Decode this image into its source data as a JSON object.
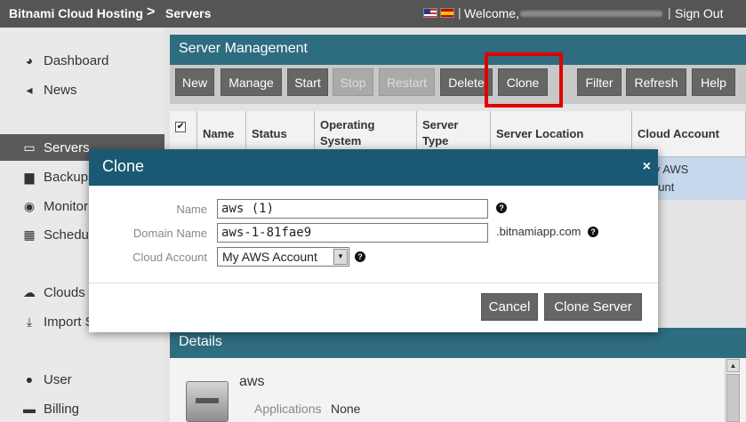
{
  "topbar": {
    "crumb1": "Bitnami Cloud Hosting",
    "separator": ">",
    "crumb2": "Servers",
    "flags": [
      "us-flag",
      "es-flag"
    ],
    "pipe": "|",
    "welcome": "Welcome,",
    "signout": "Sign Out"
  },
  "sidebar": {
    "items": [
      {
        "label": "Dashboard",
        "icon": "dashboard-icon",
        "glyph": "◕"
      },
      {
        "label": "News",
        "icon": "megaphone-icon",
        "glyph": "📢"
      },
      {
        "label": "Servers",
        "icon": "server-icon",
        "glyph": "▭"
      },
      {
        "label": "Backups",
        "icon": "archive-icon",
        "glyph": "▆"
      },
      {
        "label": "Monitor",
        "icon": "eye-icon",
        "glyph": "◉"
      },
      {
        "label": "Schedule",
        "icon": "calendar-icon",
        "glyph": "▦"
      },
      {
        "label": "Clouds",
        "icon": "cloud-icon",
        "glyph": "☁"
      },
      {
        "label": "Import Server",
        "icon": "import-icon",
        "glyph": "⤓"
      },
      {
        "label": "User",
        "icon": "user-icon",
        "glyph": "●"
      },
      {
        "label": "Billing",
        "icon": "credit-card-icon",
        "glyph": "▬"
      }
    ]
  },
  "main": {
    "title": "Server Management",
    "toolbar": {
      "new": "New",
      "manage": "Manage",
      "start": "Start",
      "stop": "Stop",
      "restart": "Restart",
      "delete": "Delete",
      "clone": "Clone",
      "filter": "Filter",
      "refresh": "Refresh",
      "help": "Help"
    },
    "table": {
      "check": "✔",
      "columns": [
        "Name",
        "Status",
        "Operating System",
        "Server Type",
        "Server Location",
        "Cloud Account"
      ],
      "row_partial": {
        "cloud_account_line1": "My AWS",
        "cloud_account_line2": "ount"
      }
    }
  },
  "modal": {
    "title": "Clone",
    "close": "×",
    "name_label": "Name",
    "name_value": "aws (1)",
    "domain_label": "Domain Name",
    "domain_value": "aws-1-81fae9",
    "domain_suffix": ".bitnamiapp.com",
    "cloud_label": "Cloud Account",
    "cloud_value": "My AWS Account",
    "help": "?",
    "cancel": "Cancel",
    "clone_server": "Clone Server"
  },
  "details": {
    "title": "Details",
    "server_name": "aws",
    "applications_label": "Applications",
    "applications_value": "None"
  },
  "colors": {
    "header_blue": "#2e6c80",
    "modal_head": "#1a5974",
    "button_gray": "#666666",
    "highlight_red": "#e00000",
    "active_nav": "#5a5a5a"
  }
}
